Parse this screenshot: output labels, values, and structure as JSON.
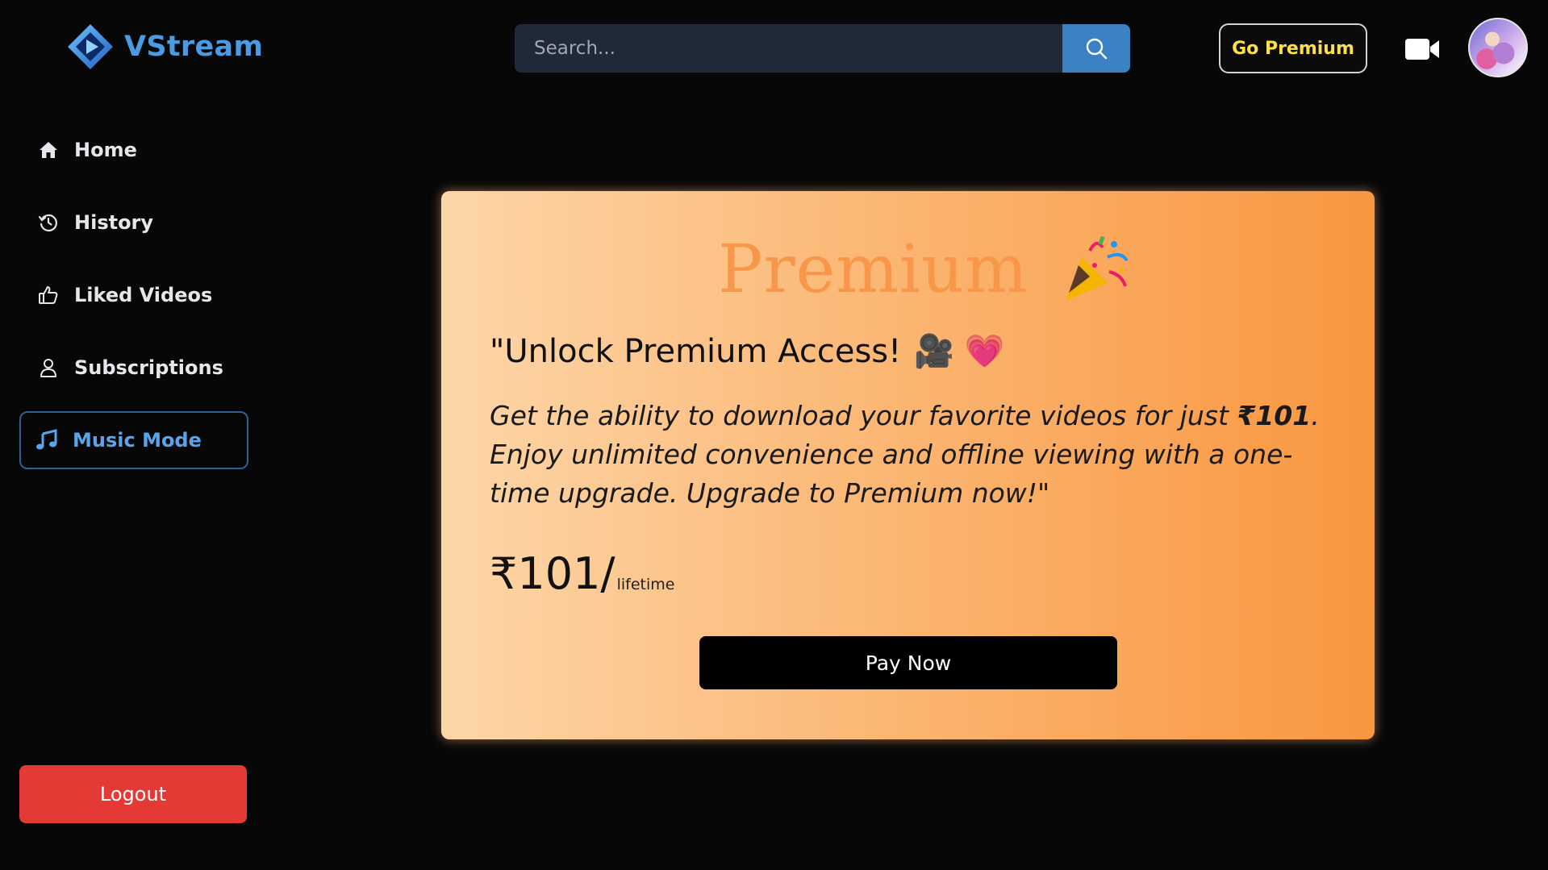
{
  "app": {
    "name": "VStream",
    "brand_color": "#4a9be3"
  },
  "header": {
    "search": {
      "placeholder": "Search...",
      "value": ""
    },
    "go_premium_label": "Go Premium",
    "accent_color": "#fde047"
  },
  "sidebar": {
    "items": [
      {
        "label": "Home",
        "icon": "home-icon",
        "active": false
      },
      {
        "label": "History",
        "icon": "history-icon",
        "active": false
      },
      {
        "label": "Liked Videos",
        "icon": "thumbs-up-icon",
        "active": false
      },
      {
        "label": "Subscriptions",
        "icon": "user-icon",
        "active": false
      },
      {
        "label": "Music Mode",
        "icon": "music-note-icon",
        "active": true
      }
    ],
    "logout_label": "Logout",
    "logout_color": "#e53935"
  },
  "premium_card": {
    "title": "Premium",
    "title_emoji": "🎉",
    "headline": "\"Unlock Premium Access!",
    "headline_emojis": "🎥 💗",
    "description_prefix": "Get the ability to download your favorite videos for just ",
    "description_price": "₹101",
    "description_suffix": ". Enjoy unlimited convenience and offline viewing with a one-time upgrade. Upgrade to Premium now!\"",
    "price_amount": "₹101/",
    "price_period": "lifetime",
    "pay_label": "Pay Now"
  }
}
